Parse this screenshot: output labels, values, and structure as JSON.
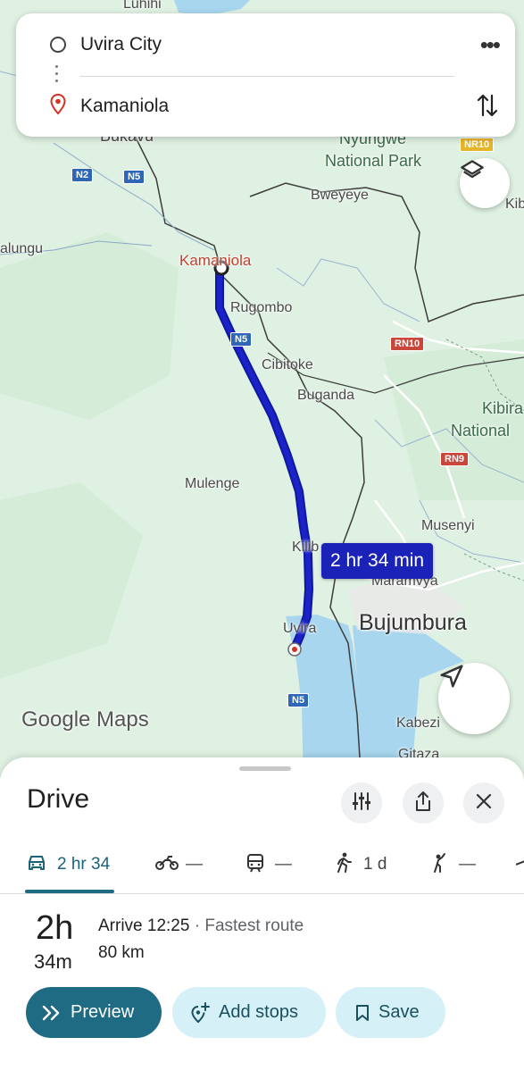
{
  "search": {
    "origin": "Uvira City",
    "destination": "Kamaniola"
  },
  "map": {
    "labels": {
      "luhihi": "Luhihi",
      "bukavu": "Bukavu",
      "nyungwe": "Nyungwe",
      "national_park": "National Park",
      "kib_top": "Kib",
      "kalungu": "alungu",
      "bweyeye": "Bweyeye",
      "kamaniola": "Kamaniola",
      "rugombo": "Rugombo",
      "cibitoke": "Cibitoke",
      "buganda": "Buganda",
      "kibira": "Kibira",
      "national": "National",
      "mulenge": "Mulenge",
      "musenyi": "Musenyi",
      "kiliba": "Kilib",
      "maramvya": "Maramvya",
      "bujumbura": "Bujumbura",
      "uvira": "Uvira",
      "kabezi": "Kabezi",
      "gitaza": "Gitaza"
    },
    "shields": {
      "n2": "N2",
      "n5_top": "N5",
      "n5_mid": "N5",
      "n5_low": "N5",
      "nr10": "NR10",
      "rn10": "RN10",
      "rn9": "RN9"
    },
    "route_duration": "2 hr 34 min",
    "logo": "Google Maps",
    "colors": {
      "route": "#1a22c8",
      "route_tag": "#1a22b8",
      "water": "#a8d6ee",
      "land": "#dff1e2"
    }
  },
  "sheet": {
    "title": "Drive",
    "modes": [
      {
        "icon": "car-icon",
        "label": "2 hr 34"
      },
      {
        "icon": "motorcycle-icon",
        "label": "—"
      },
      {
        "icon": "train-icon",
        "label": "—"
      },
      {
        "icon": "walk-icon",
        "label": "1 d"
      },
      {
        "icon": "ride-hail-icon",
        "label": "—"
      }
    ],
    "duration_hours": "2h",
    "duration_minutes": "34m",
    "arrive": "Arrive 12:25",
    "route_note": "Fastest route",
    "distance": "80 km",
    "buttons": {
      "preview": "Preview",
      "add_stops": "Add stops",
      "save": "Save"
    }
  }
}
